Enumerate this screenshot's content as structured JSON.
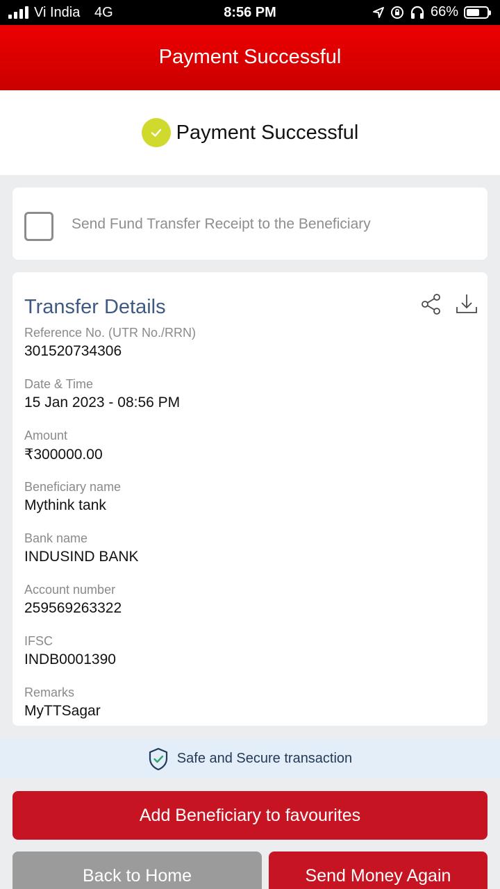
{
  "status_bar": {
    "carrier": "Vi India",
    "network": "4G",
    "time": "8:56 PM",
    "battery": "66%",
    "battery_level": 0.66,
    "icons": [
      "signal-bars-icon",
      "location-arrow-icon",
      "rotation-lock-icon",
      "headphones-icon",
      "battery-icon"
    ]
  },
  "header": {
    "title": "Payment Successful"
  },
  "banner": {
    "message": "Payment Successful",
    "icon": "check-circle-icon",
    "icon_color": "#cfd92e"
  },
  "receipt_option": {
    "label": "Send Fund Transfer Receipt to the Beneficiary",
    "checked": false
  },
  "transfer_details": {
    "title": "Transfer Details",
    "actions": [
      "share-icon",
      "download-icon"
    ],
    "fields": [
      {
        "label": "Reference No. (UTR No./RRN)",
        "value": "301520734306"
      },
      {
        "label": "Date & Time",
        "value": "15 Jan 2023 - 08:56 PM"
      },
      {
        "label": "Amount",
        "value": "₹300000.00"
      },
      {
        "label": "Beneficiary name",
        "value": "Mythink tank"
      },
      {
        "label": "Bank name",
        "value": "INDUSIND BANK"
      },
      {
        "label": "Account number",
        "value": "259569263322"
      },
      {
        "label": "IFSC",
        "value": "INDB0001390"
      },
      {
        "label": "Remarks",
        "value": "MyTTSagar"
      }
    ]
  },
  "secure_note": {
    "text": "Safe and Secure transaction",
    "icon": "shield-check-icon"
  },
  "buttons": {
    "add_favourite": "Add Beneficiary to favourites",
    "back_home": "Back to Home",
    "send_again": "Send Money Again"
  },
  "colors": {
    "header_red": "#e00000",
    "button_red": "#c71422",
    "button_grey": "#9b9b9b",
    "title_blue": "#3e5a83",
    "secure_bg": "#e4eef9"
  }
}
